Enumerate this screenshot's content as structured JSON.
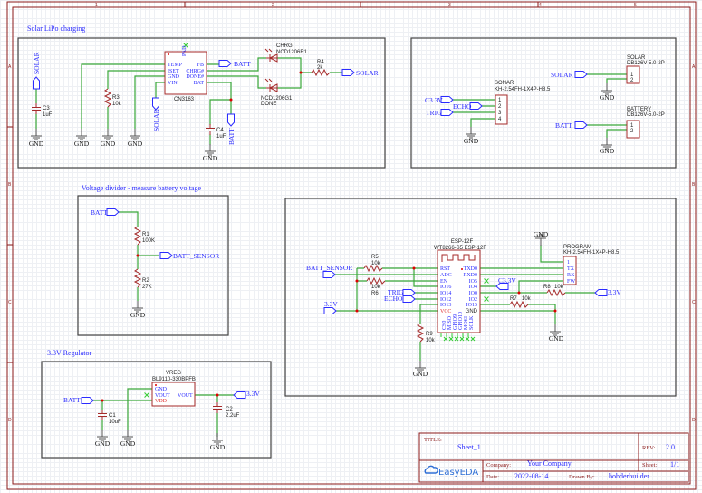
{
  "sheet": {
    "column_markers": [
      "1",
      "2",
      "3",
      "4",
      "5"
    ],
    "row_markers": [
      "A",
      "B",
      "C",
      "D"
    ],
    "gnd": "GND",
    "colors": {
      "frame": "#8b1a1a",
      "wire": "#3aa83a",
      "net_label": "#2b2bff",
      "component": "#a52a2a",
      "junction": "#dd0000",
      "no_connect": "#33cc33"
    }
  },
  "nets": {
    "batt": "BATT",
    "solar": "SOLAR",
    "batt_sensor": "BATT_SENSOR",
    "v33": "3.3V",
    "c33": "C3.3V",
    "trig": "TRIG",
    "echo": "ECHO"
  },
  "solar_charging": {
    "title": "Solar LiPo charging",
    "ic": {
      "name": "CN3163",
      "pad": "PAD",
      "pins_left": [
        "TEMP",
        "ISET",
        "GND",
        "VIN"
      ],
      "pins_right": [
        "FB",
        "CHRG#",
        "DONE#",
        "BAT"
      ]
    },
    "r3": {
      "ref": "R3",
      "value": "10k"
    },
    "r4": {
      "ref": "R4",
      "value": "2k"
    },
    "c3": {
      "ref": "C3",
      "value": "1uF"
    },
    "c4": {
      "ref": "C4",
      "value": "1uF"
    },
    "led_chrg": {
      "ref": "CHRG",
      "part": "NCD1206R1"
    },
    "led_done": {
      "ref": "DONE",
      "part": "NCD1206G1"
    }
  },
  "connectors": {
    "sonar": {
      "ref": "SONAR",
      "part": "KH-2.54FH-1X4P-H8.5",
      "pins": [
        "1",
        "2",
        "3",
        "4"
      ]
    },
    "solar": {
      "ref": "SOLAR",
      "part": "DB126V-5.0-2P",
      "pins": [
        "1",
        "2"
      ]
    },
    "battery": {
      "ref": "BATTERY",
      "part": "DB126V-5.0-2P",
      "pins": [
        "1",
        "2"
      ]
    }
  },
  "divider": {
    "title": "Voltage divider - measure battery voltage",
    "r1": {
      "ref": "R1",
      "value": "100K"
    },
    "r2": {
      "ref": "R2",
      "value": "27K"
    }
  },
  "esp": {
    "ref": "ESP-12F",
    "part": "WT8266-S5 ESP-12F",
    "pins_left": [
      "RST",
      "ADC",
      "EN",
      "IO16",
      "IO14",
      "IO12",
      "IO13",
      "VCC"
    ],
    "pins_right": [
      "TXD0",
      "RXD0",
      "IO5",
      "IO4",
      "IO0",
      "IO2",
      "IO15",
      "GND"
    ],
    "pins_bottom": [
      "CS0",
      "MISO",
      "GPIO9",
      "GPIO10",
      "MOSI",
      "SCLK"
    ],
    "r5": {
      "ref": "R5",
      "value": "10k"
    },
    "r6": {
      "ref": "R6",
      "value": "10k"
    },
    "r7": {
      "ref": "R7",
      "value": "10k"
    },
    "r8": {
      "ref": "R8",
      "value": "10k"
    },
    "r9": {
      "ref": "R9",
      "value": "10k"
    },
    "program": {
      "ref": "PROGRAM",
      "part": "KH-2.54FH-1X4P-H8.5",
      "pins": [
        "1",
        "TX",
        "RX",
        "FW"
      ]
    }
  },
  "regulator": {
    "title": "3.3V Regulator",
    "ic": {
      "ref": "VREG",
      "part": "BL9110-330BPFB",
      "pins_left": [
        "GND",
        "VOUT",
        "VDD"
      ],
      "pin_right": "VOUT"
    },
    "c1": {
      "ref": "C1",
      "value": "10uF"
    },
    "c2": {
      "ref": "C2",
      "value": "2.2uF"
    }
  },
  "title_block": {
    "title_label": "TITLE:",
    "title": "Sheet_1",
    "rev_label": "REV:",
    "rev": "2.0",
    "company_label": "Company:",
    "company": "Your Company",
    "sheet_label": "Sheet:",
    "sheet": "1/1",
    "date_label": "Date:",
    "date": "2022-08-14",
    "drawn_label": "Drawn By:",
    "drawn_by": "bobderbuilder",
    "logo": "EasyEDA"
  }
}
